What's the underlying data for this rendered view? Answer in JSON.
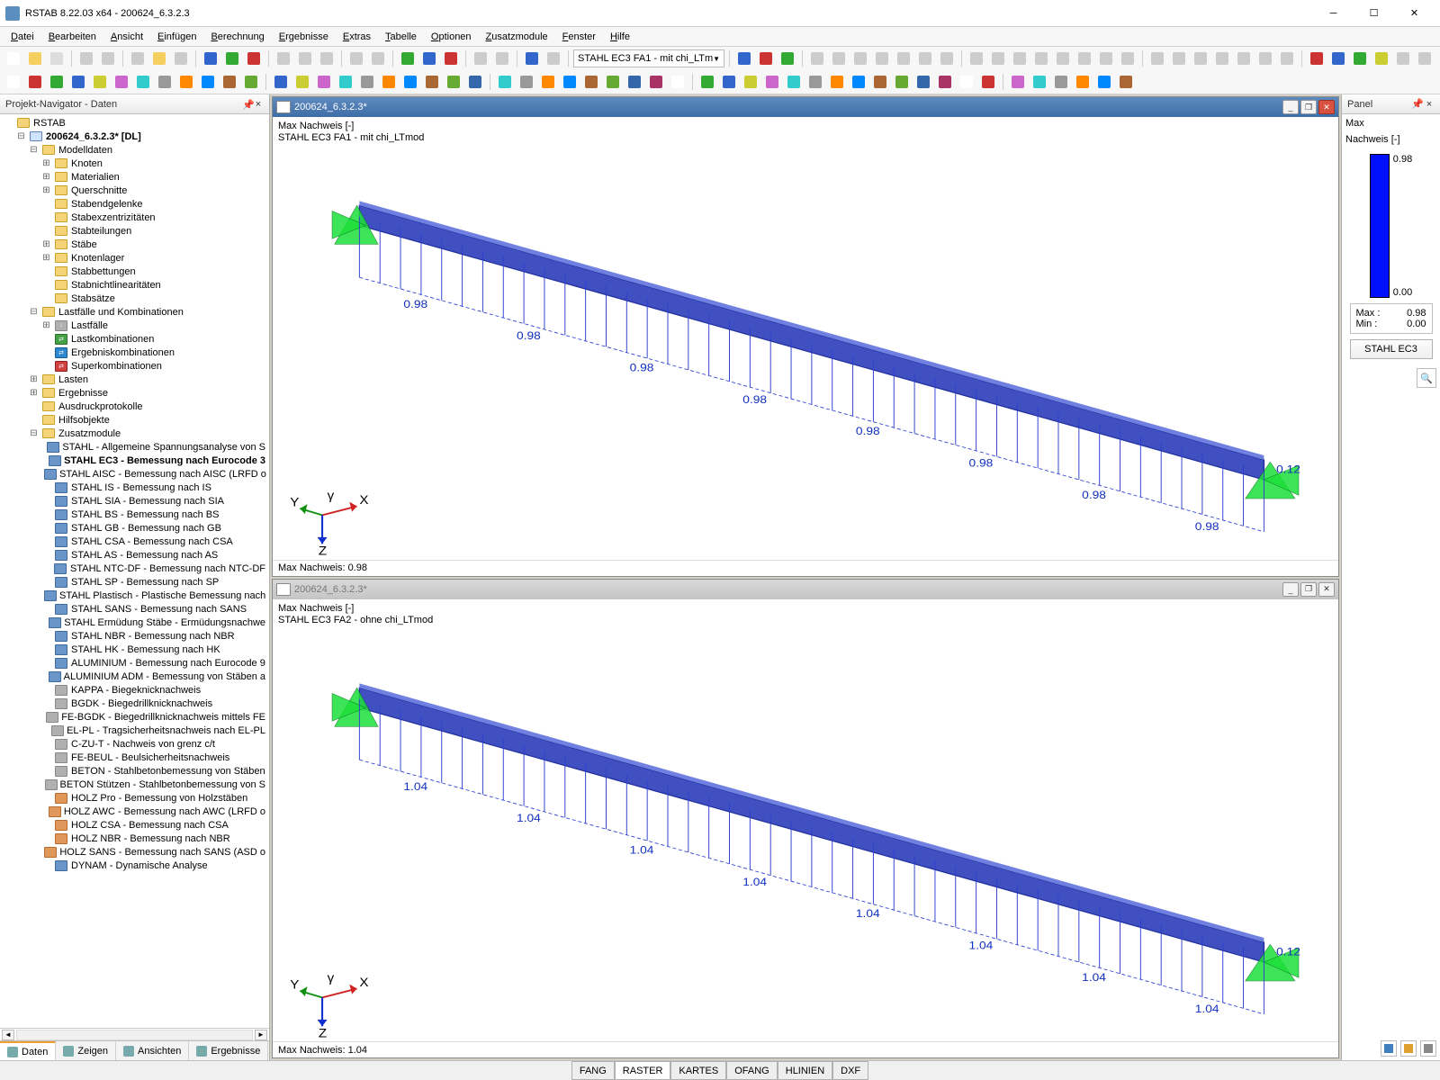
{
  "window": {
    "title": "RSTAB 8.22.03 x64 - 200624_6.3.2.3"
  },
  "menu": [
    "Datei",
    "Bearbeiten",
    "Ansicht",
    "Einfügen",
    "Berechnung",
    "Ergebnisse",
    "Extras",
    "Tabelle",
    "Optionen",
    "Zusatzmodule",
    "Fenster",
    "Hilfe"
  ],
  "combo1": "STAHL EC3 FA1 - mit chi_LTm",
  "navigator": {
    "title": "Projekt-Navigator - Daten",
    "root": "RSTAB",
    "project": "200624_6.3.2.3* [DL]",
    "modelldaten": {
      "label": "Modelldaten",
      "children": [
        "Knoten",
        "Materialien",
        "Querschnitte",
        "Stabendgelenke",
        "Stabexzentrizitäten",
        "Stabteilungen",
        "Stäbe",
        "Knotenlager",
        "Stabbettungen",
        "Stabnichtlinearitäten",
        "Stabsätze"
      ]
    },
    "lastfaelle": {
      "label": "Lastfälle und Kombinationen",
      "children": [
        "Lastfälle",
        "Lastkombinationen",
        "Ergebniskombinationen",
        "Superkombinationen"
      ]
    },
    "simple": [
      "Lasten",
      "Ergebnisse",
      "Ausdruckprotokolle",
      "Hilfsobjekte"
    ],
    "zusatz": {
      "label": "Zusatzmodule",
      "items": [
        "STAHL - Allgemeine Spannungsanalyse von S",
        "STAHL EC3 - Bemessung nach Eurocode 3",
        "STAHL AISC - Bemessung nach AISC (LRFD o",
        "STAHL IS - Bemessung nach IS",
        "STAHL SIA - Bemessung nach SIA",
        "STAHL BS - Bemessung nach BS",
        "STAHL GB - Bemessung nach GB",
        "STAHL CSA - Bemessung nach CSA",
        "STAHL AS - Bemessung nach AS",
        "STAHL NTC-DF - Bemessung nach NTC-DF",
        "STAHL SP - Bemessung nach SP",
        "STAHL Plastisch - Plastische Bemessung nach",
        "STAHL SANS - Bemessung nach SANS",
        "STAHL Ermüdung Stäbe - Ermüdungsnachwe",
        "STAHL NBR - Bemessung nach NBR",
        "STAHL HK - Bemessung nach HK",
        "ALUMINIUM - Bemessung nach Eurocode 9",
        "ALUMINIUM ADM - Bemessung von Stäben a",
        "KAPPA - Biegeknicknachweis",
        "BGDK - Biegedrillknicknachweis",
        "FE-BGDK - Biegedrillknicknachweis mittels FE",
        "EL-PL - Tragsicherheitsnachweis nach EL-PL",
        "C-ZU-T - Nachweis von grenz c/t",
        "FE-BEUL - Beulsicherheitsnachweis",
        "BETON - Stahlbetonbemessung von Stäben",
        "BETON Stützen - Stahlbetonbemessung von S",
        "HOLZ Pro - Bemessung von Holzstäben",
        "HOLZ AWC - Bemessung nach AWC (LRFD o",
        "HOLZ CSA - Bemessung nach CSA",
        "HOLZ NBR - Bemessung nach NBR",
        "HOLZ SANS - Bemessung nach SANS (ASD o",
        "DYNAM - Dynamische Analyse"
      ]
    },
    "tabs": [
      "Daten",
      "Zeigen",
      "Ansichten",
      "Ergebnisse"
    ]
  },
  "views": {
    "top": {
      "title": "200624_6.3.2.3*",
      "line1": "Max Nachweis [-]",
      "line2": "STAHL EC3 FA1 - mit chi_LTmod",
      "footer": "Max Nachweis: 0.98",
      "values": [
        "0.98",
        "0.98",
        "0.98",
        "0.98",
        "0.98",
        "0.98",
        "0.98",
        "0.98"
      ],
      "end": "0.12"
    },
    "bottom": {
      "title": "200624_6.3.2.3*",
      "line1": "Max Nachweis [-]",
      "line2": "STAHL EC3 FA2 - ohne chi_LTmod",
      "footer": "Max Nachweis: 1.04",
      "values": [
        "1.04",
        "1.04",
        "1.04",
        "1.04",
        "1.04",
        "1.04",
        "1.04",
        "1.04"
      ],
      "end": "0.12"
    }
  },
  "panel": {
    "title": "Panel",
    "h1": "Max",
    "h2": "Nachweis [-]",
    "scale_max": "0.98",
    "scale_min": "0.00",
    "stat_max_label": "Max  :",
    "stat_max": "0.98",
    "stat_min_label": "Min   :",
    "stat_min": "0.00",
    "button": "STAHL EC3"
  },
  "status": [
    "FANG",
    "RASTER",
    "KARTES",
    "OFANG",
    "HLINIEN",
    "DXF"
  ],
  "axes": {
    "x": "X",
    "y": "Y",
    "z": "Z",
    "angle": "γ"
  }
}
